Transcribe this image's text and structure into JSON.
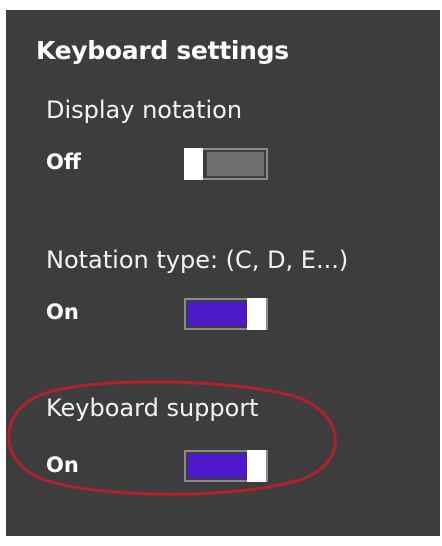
{
  "panel": {
    "title": "Keyboard settings",
    "settings": [
      {
        "label": "Display notation",
        "state": "Off",
        "on": false
      },
      {
        "label": "Notation type: (C, D, E...)",
        "state": "On",
        "on": true
      },
      {
        "label": "Keyboard support",
        "state": "On",
        "on": true
      }
    ]
  },
  "colors": {
    "panel_bg": "#3d3d3d",
    "toggle_on_fill": "#4b19c9",
    "toggle_off_fill": "#6e6e6e",
    "highlight_ellipse": "#b3202a"
  }
}
